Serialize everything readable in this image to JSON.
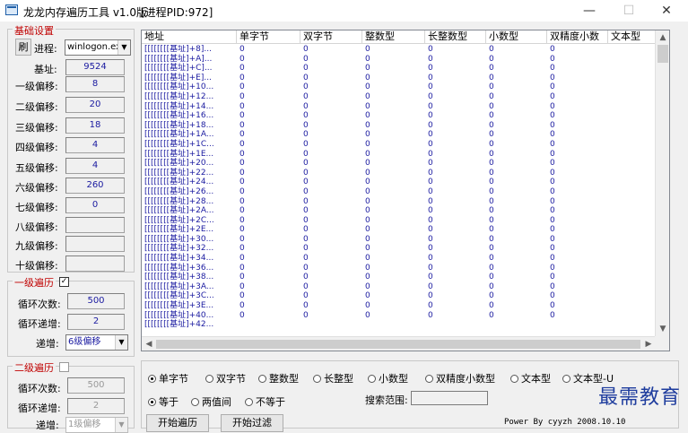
{
  "window": {
    "title": "龙龙内存遍历工具 v1.0版",
    "pid_label": "[进程PID:972]",
    "minimize_glyph": "—",
    "maximize_glyph": "☐",
    "close_glyph": "✕"
  },
  "basic": {
    "group_title": "基础设置",
    "refresh_label": "刷",
    "process_label": "进程:",
    "process_value": "winlogon.ex",
    "base_label": "基址:",
    "base_value": "9524",
    "offsets": [
      {
        "label": "一级偏移:",
        "value": "8"
      },
      {
        "label": "二级偏移:",
        "value": "20"
      },
      {
        "label": "三级偏移:",
        "value": "18"
      },
      {
        "label": "四级偏移:",
        "value": "4"
      },
      {
        "label": "五级偏移:",
        "value": "4"
      },
      {
        "label": "六级偏移:",
        "value": "260"
      },
      {
        "label": "七级偏移:",
        "value": "0"
      },
      {
        "label": "八级偏移:",
        "value": ""
      },
      {
        "label": "九级偏移:",
        "value": ""
      },
      {
        "label": "十级偏移:",
        "value": ""
      }
    ]
  },
  "level1": {
    "title": "一级遍历",
    "checked": true,
    "count_label": "循环次数:",
    "count_value": "500",
    "step_label": "循环递增:",
    "step_value": "2",
    "inc_label": "递增:",
    "inc_value": "6级偏移"
  },
  "level2": {
    "title": "二级遍历",
    "checked": false,
    "count_label": "循环次数:",
    "count_value": "500",
    "step_label": "循环递增:",
    "step_value": "2",
    "inc_label": "递增:",
    "inc_value": "1级偏移"
  },
  "table": {
    "columns": [
      "地址",
      "单字节",
      "双字节",
      "整数型",
      "长整数型",
      "小数型",
      "双精度小数",
      "文本型"
    ],
    "rows": [
      {
        "addr": "[[[[[[[[基址]+8]...",
        "v": [
          "0",
          "0",
          "0",
          "0",
          "0",
          "0",
          ""
        ]
      },
      {
        "addr": "[[[[[[[[基址]+A]...",
        "v": [
          "0",
          "0",
          "0",
          "0",
          "0",
          "0",
          ""
        ]
      },
      {
        "addr": "[[[[[[[[基址]+C]...",
        "v": [
          "0",
          "0",
          "0",
          "0",
          "0",
          "0",
          ""
        ]
      },
      {
        "addr": "[[[[[[[[基址]+E]...",
        "v": [
          "0",
          "0",
          "0",
          "0",
          "0",
          "0",
          ""
        ]
      },
      {
        "addr": "[[[[[[[[基址]+10...",
        "v": [
          "0",
          "0",
          "0",
          "0",
          "0",
          "0",
          ""
        ]
      },
      {
        "addr": "[[[[[[[[基址]+12...",
        "v": [
          "0",
          "0",
          "0",
          "0",
          "0",
          "0",
          ""
        ]
      },
      {
        "addr": "[[[[[[[[基址]+14...",
        "v": [
          "0",
          "0",
          "0",
          "0",
          "0",
          "0",
          ""
        ]
      },
      {
        "addr": "[[[[[[[[基址]+16...",
        "v": [
          "0",
          "0",
          "0",
          "0",
          "0",
          "0",
          ""
        ]
      },
      {
        "addr": "[[[[[[[[基址]+18...",
        "v": [
          "0",
          "0",
          "0",
          "0",
          "0",
          "0",
          ""
        ]
      },
      {
        "addr": "[[[[[[[[基址]+1A...",
        "v": [
          "0",
          "0",
          "0",
          "0",
          "0",
          "0",
          ""
        ]
      },
      {
        "addr": "[[[[[[[[基址]+1C...",
        "v": [
          "0",
          "0",
          "0",
          "0",
          "0",
          "0",
          ""
        ]
      },
      {
        "addr": "[[[[[[[[基址]+1E...",
        "v": [
          "0",
          "0",
          "0",
          "0",
          "0",
          "0",
          ""
        ]
      },
      {
        "addr": "[[[[[[[[基址]+20...",
        "v": [
          "0",
          "0",
          "0",
          "0",
          "0",
          "0",
          ""
        ]
      },
      {
        "addr": "[[[[[[[[基址]+22...",
        "v": [
          "0",
          "0",
          "0",
          "0",
          "0",
          "0",
          ""
        ]
      },
      {
        "addr": "[[[[[[[[基址]+24...",
        "v": [
          "0",
          "0",
          "0",
          "0",
          "0",
          "0",
          ""
        ]
      },
      {
        "addr": "[[[[[[[[基址]+26...",
        "v": [
          "0",
          "0",
          "0",
          "0",
          "0",
          "0",
          ""
        ]
      },
      {
        "addr": "[[[[[[[[基址]+28...",
        "v": [
          "0",
          "0",
          "0",
          "0",
          "0",
          "0",
          ""
        ]
      },
      {
        "addr": "[[[[[[[[基址]+2A...",
        "v": [
          "0",
          "0",
          "0",
          "0",
          "0",
          "0",
          ""
        ]
      },
      {
        "addr": "[[[[[[[[基址]+2C...",
        "v": [
          "0",
          "0",
          "0",
          "0",
          "0",
          "0",
          ""
        ]
      },
      {
        "addr": "[[[[[[[[基址]+2E...",
        "v": [
          "0",
          "0",
          "0",
          "0",
          "0",
          "0",
          ""
        ]
      },
      {
        "addr": "[[[[[[[[基址]+30...",
        "v": [
          "0",
          "0",
          "0",
          "0",
          "0",
          "0",
          ""
        ]
      },
      {
        "addr": "[[[[[[[[基址]+32...",
        "v": [
          "0",
          "0",
          "0",
          "0",
          "0",
          "0",
          ""
        ]
      },
      {
        "addr": "[[[[[[[[基址]+34...",
        "v": [
          "0",
          "0",
          "0",
          "0",
          "0",
          "0",
          ""
        ]
      },
      {
        "addr": "[[[[[[[[基址]+36...",
        "v": [
          "0",
          "0",
          "0",
          "0",
          "0",
          "0",
          ""
        ]
      },
      {
        "addr": "[[[[[[[[基址]+38...",
        "v": [
          "0",
          "0",
          "0",
          "0",
          "0",
          "0",
          ""
        ]
      },
      {
        "addr": "[[[[[[[[基址]+3A...",
        "v": [
          "0",
          "0",
          "0",
          "0",
          "0",
          "0",
          ""
        ]
      },
      {
        "addr": "[[[[[[[[基址]+3C...",
        "v": [
          "0",
          "0",
          "0",
          "0",
          "0",
          "0",
          ""
        ]
      },
      {
        "addr": "[[[[[[[[基址]+3E...",
        "v": [
          "0",
          "0",
          "0",
          "0",
          "0",
          "0",
          ""
        ]
      },
      {
        "addr": "[[[[[[[[基址]+40...",
        "v": [
          "0",
          "0",
          "0",
          "0",
          "0",
          "0",
          ""
        ]
      },
      {
        "addr": "[[[[[[[[基址]+42...",
        "v": [
          "",
          "",
          "",
          "",
          "",
          "",
          ""
        ]
      }
    ]
  },
  "search": {
    "types": [
      "单字节",
      "双字节",
      "整数型",
      "长整型",
      "小数型",
      "双精度小数型",
      "文本型",
      "文本型-U"
    ],
    "selected_type": 0,
    "compare": [
      "等于",
      "两值间",
      "不等于"
    ],
    "selected_compare": 0,
    "range_label": "搜索范围:",
    "start_button": "开始遍历",
    "filter_button": "开始过滤",
    "footer": "Power By cyyzh 2008.10.10",
    "watermark": "最需教育"
  }
}
